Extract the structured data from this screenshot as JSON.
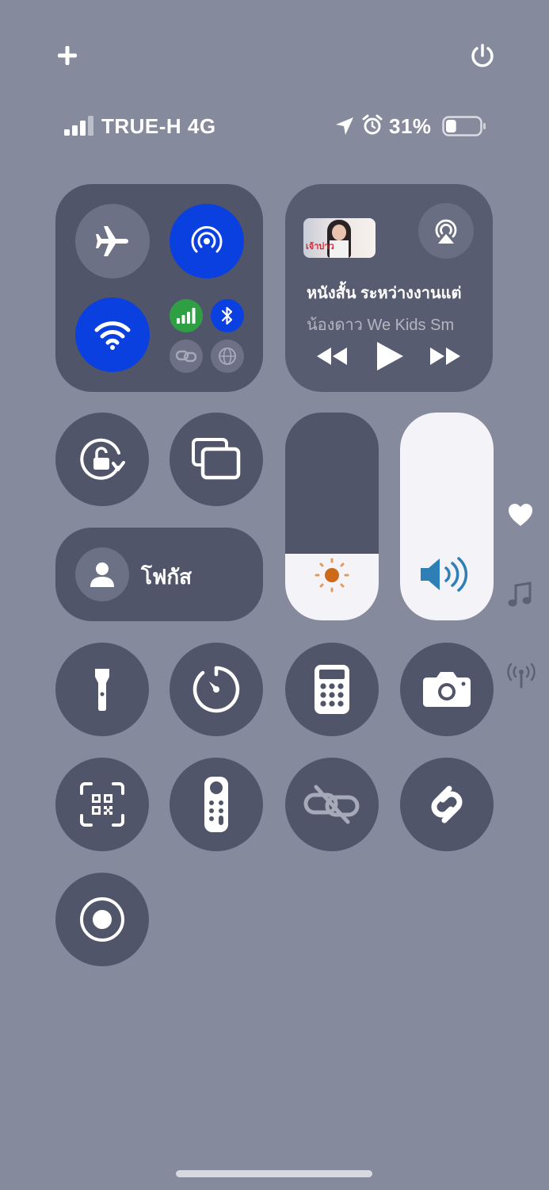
{
  "status": {
    "carrier": "TRUE-H 4G",
    "battery_percent": "31%",
    "battery_level": 0.31,
    "signal_bars": 3
  },
  "top": {
    "add_icon": "plus-icon",
    "power_icon": "power-icon"
  },
  "connectivity": {
    "airplane": {
      "icon": "airplane-icon",
      "active": false
    },
    "airdrop": {
      "icon": "airdrop-icon",
      "active": true
    },
    "wifi": {
      "icon": "wifi-icon",
      "active": true
    },
    "cellular": {
      "icon": "cellular-bars-icon",
      "active": true
    },
    "bluetooth": {
      "icon": "bluetooth-icon",
      "active": true
    },
    "hotspot": {
      "icon": "personal-hotspot-icon",
      "active": false
    },
    "vpn": {
      "icon": "globe-vpn-icon",
      "active": false
    }
  },
  "media": {
    "title": "หนังสั้น ระหว่างงานแต่",
    "artist": "น้องดาว We Kids Sm",
    "thumbnail_text": "เจ้าบ่าว"
  },
  "focus": {
    "label": "โฟกัส"
  },
  "sliders": {
    "brightness_level": 0.32,
    "volume_level": 1.0
  },
  "colors": {
    "background": "#858a9c",
    "tile": "#51556a",
    "active_blue": "#0a3fe0",
    "cellular_green": "#2ea043",
    "slider_fill": "#f4f4f8",
    "brightness_orange": "#cc6a1a",
    "volume_blue": "#2e7fb6"
  },
  "side_indicators": [
    "heart-icon",
    "music-note-icon",
    "antenna-icon"
  ]
}
